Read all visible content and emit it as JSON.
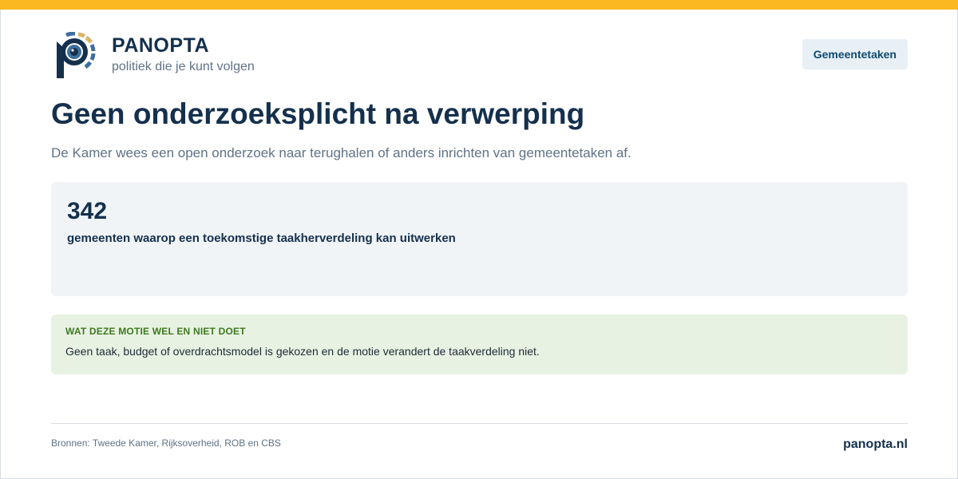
{
  "brand": {
    "name": "PANOPTA",
    "tagline": "politiek die je kunt volgen",
    "colors": {
      "accent": "#fbb820",
      "primary": "#14304d",
      "logo_blue": "#3f6ea0",
      "logo_gold": "#d9b56c"
    }
  },
  "header": {
    "topic_button_label": "Gemeentetaken"
  },
  "main": {
    "title": "Geen onderzoeksplicht na verwerping",
    "subtitle": "De Kamer wees een open onderzoek naar terughalen of anders inrichten van gemeentetaken af.",
    "stat": {
      "value": "342",
      "label": "gemeenten waarop een toekomstige taakherverdeling kan uitwerken"
    },
    "note": {
      "heading": "WAT DEZE MOTIE WEL EN NIET DOET",
      "text": "Geen taak, budget of overdrachtsmodel is gekozen en de motie verandert de taakverdeling niet."
    }
  },
  "footer": {
    "sources": "Bronnen: Tweede Kamer, Rijksoverheid, ROB en CBS",
    "site": "panopta.nl"
  },
  "icons": {
    "logo": "panopta-eye-logo"
  }
}
